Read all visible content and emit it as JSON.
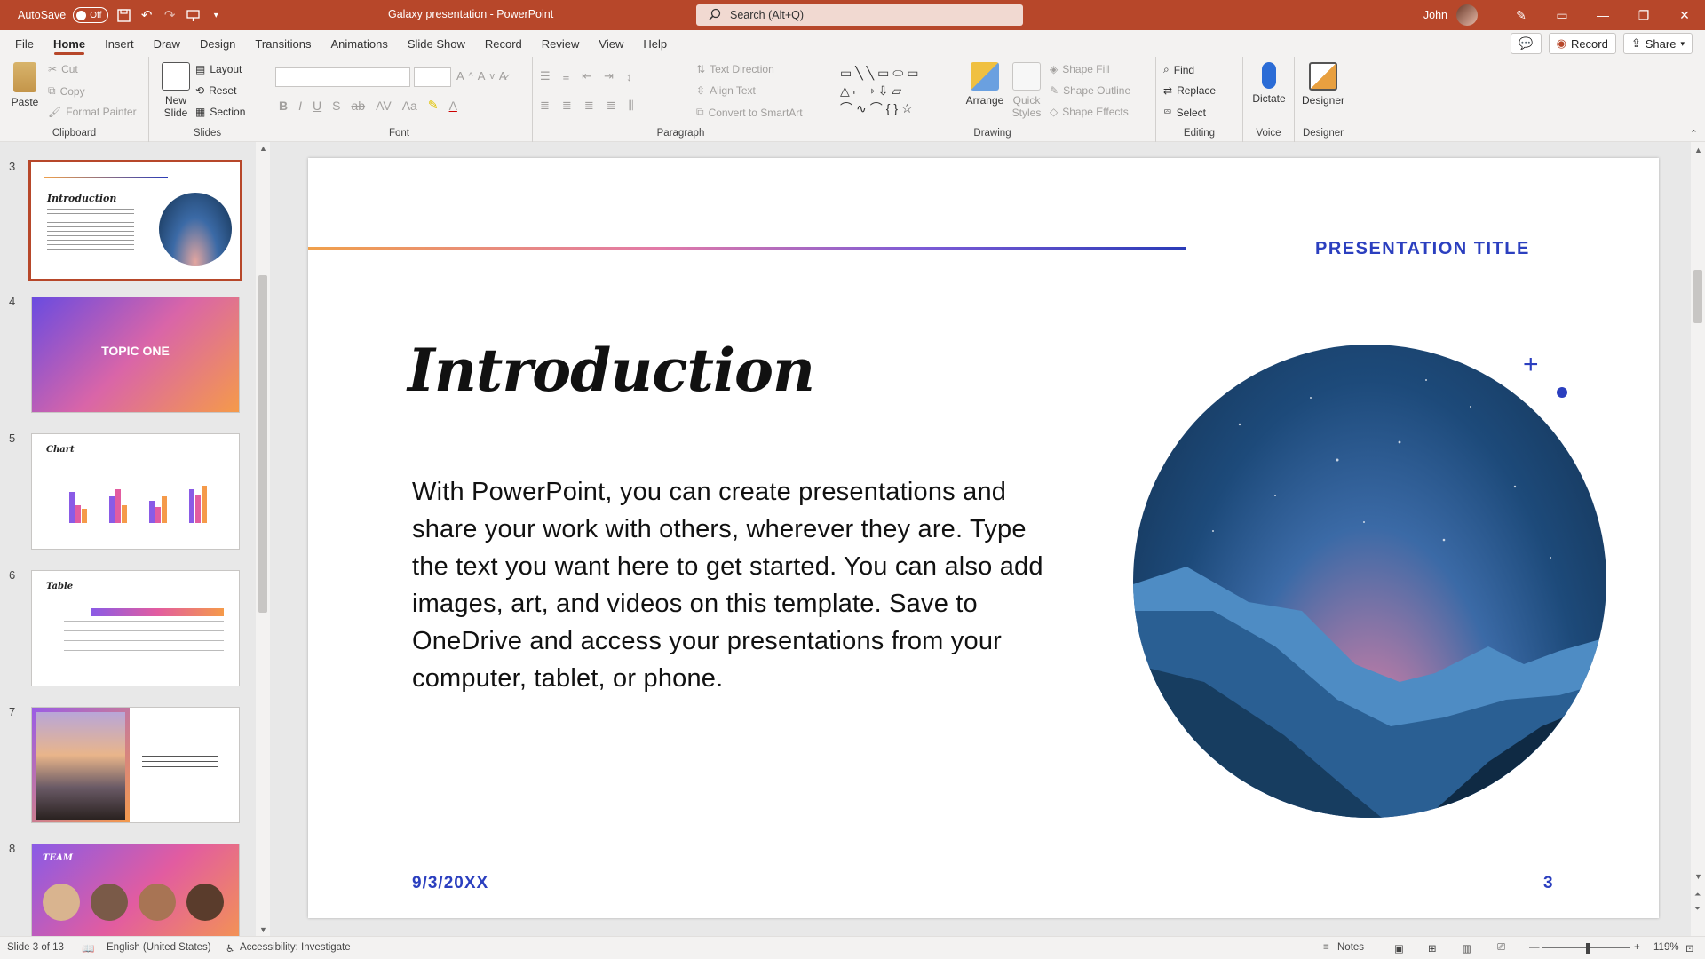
{
  "titlebar": {
    "autosave_label": "AutoSave",
    "autosave_state": "Off",
    "doc_title": "Galaxy presentation  -  PowerPoint",
    "search_placeholder": "Search (Alt+Q)",
    "user_name": "John"
  },
  "menu": {
    "tabs": [
      "File",
      "Home",
      "Insert",
      "Draw",
      "Design",
      "Transitions",
      "Animations",
      "Slide Show",
      "Record",
      "Review",
      "View",
      "Help"
    ],
    "record_button": "Record",
    "share_button": "Share"
  },
  "ribbon": {
    "clipboard": {
      "paste": "Paste",
      "cut": "Cut",
      "copy": "Copy",
      "format_painter": "Format Painter",
      "label": "Clipboard"
    },
    "slides": {
      "new_slide_1": "New",
      "new_slide_2": "Slide",
      "layout": "Layout",
      "reset": "Reset",
      "section": "Section",
      "label": "Slides"
    },
    "font": {
      "label": "Font"
    },
    "paragraph": {
      "text_direction": "Text Direction",
      "align_text": "Align Text",
      "convert_smartart": "Convert to SmartArt",
      "label": "Paragraph"
    },
    "drawing": {
      "arrange": "Arrange",
      "quick_styles_1": "Quick",
      "quick_styles_2": "Styles",
      "shape_fill": "Shape Fill",
      "shape_outline": "Shape Outline",
      "shape_effects": "Shape Effects",
      "label": "Drawing"
    },
    "editing": {
      "find": "Find",
      "replace": "Replace",
      "select": "Select",
      "label": "Editing"
    },
    "voice": {
      "dictate": "Dictate",
      "label": "Voice"
    },
    "designer": {
      "designer": "Designer",
      "label": "Designer"
    }
  },
  "thumbnails": {
    "numbers": [
      "3",
      "4",
      "5",
      "6",
      "7",
      "8"
    ],
    "t3_title": "Introduction",
    "t4_title": "TOPIC ONE",
    "t5_title": "Chart",
    "t6_title": "Table",
    "t8_title": "TEAM"
  },
  "slide": {
    "presentation_title": "PRESENTATION TITLE",
    "heading": "Introduction",
    "body": "With PowerPoint, you can create presentations and share your work with others, wherever they are. Type the text you want here to get started. You can also add images, art, and videos on this template. Save to OneDrive and access your presentations from your computer, tablet, or phone.",
    "date": "9/3/20XX",
    "number": "3"
  },
  "statusbar": {
    "slide_count": "Slide 3 of 13",
    "language": "English (United States)",
    "accessibility": "Accessibility: Investigate",
    "notes": "Notes",
    "zoom": "119%"
  },
  "colors": {
    "accent": "#b7472a",
    "slide_blue": "#2b3fbf"
  }
}
